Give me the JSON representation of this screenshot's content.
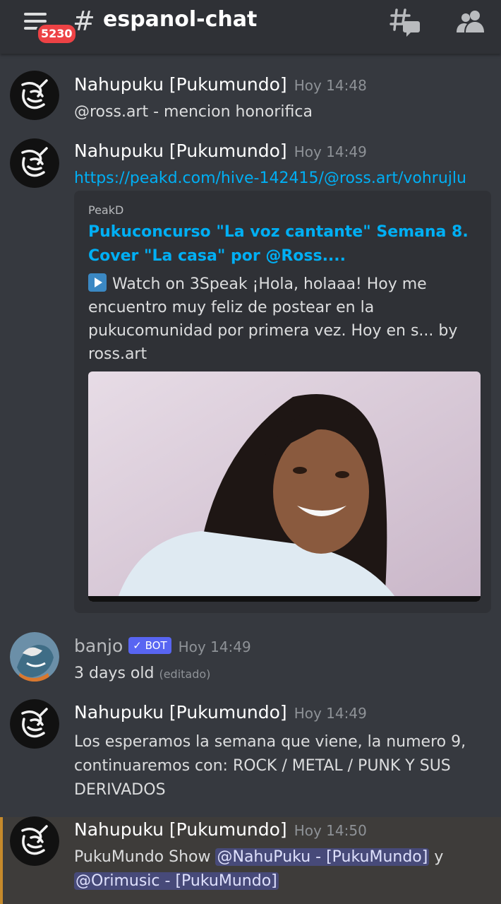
{
  "header": {
    "badge_count": "5230",
    "channel_hash": "#",
    "channel_name": "espanol-chat"
  },
  "messages": [
    {
      "author": "Nahupuku [Pukumundo]",
      "time": "Hoy 14:48",
      "text": "@ross.art - mencion honorifica"
    },
    {
      "author": "Nahupuku [Pukumundo]",
      "time": "Hoy 14:49",
      "link": "https://peakd.com/hive-142415/@ross.art/vohrujlu",
      "embed": {
        "provider": "PeakD",
        "title": "Pukuconcurso \"La voz cantante\" Semana 8. Cover \"La casa\" por @Ross....",
        "description": "Watch on 3Speak  ¡Hola, holaaa! Hoy me encuentro muy feliz de postear en la pukucomunidad por primera vez. Hoy en s... by ross.art"
      }
    },
    {
      "author": "banjo",
      "bot_tag": "✓ BOT",
      "time": "Hoy 14:49",
      "text": "3 days old",
      "edited": "(editado)"
    },
    {
      "author": "Nahupuku [Pukumundo]",
      "time": "Hoy 14:49",
      "text": "Los esperamos la semana que viene, la numero 9, continuaremos con: ROCK / METAL / PUNK Y SUS DERIVADOS"
    },
    {
      "author": "Nahupuku [Pukumundo]",
      "time": "Hoy 14:50",
      "text_prefix": "PukuMundo Show ",
      "mention_1": "@NahuPuku - [PukuMundo]",
      "text_mid": " y ",
      "mention_2": "@Orimusic - [PukuMundo]"
    }
  ],
  "icons": {
    "menu": "hamburger-menu-icon",
    "threads": "threads-icon",
    "members": "members-icon",
    "play": "play-button-icon"
  },
  "colors": {
    "background": "#36393f",
    "header": "#2f3136",
    "link": "#00aff4",
    "badge": "#ed4245",
    "bot_tag": "#5865f2",
    "mention_highlight": "#c68a2b"
  }
}
